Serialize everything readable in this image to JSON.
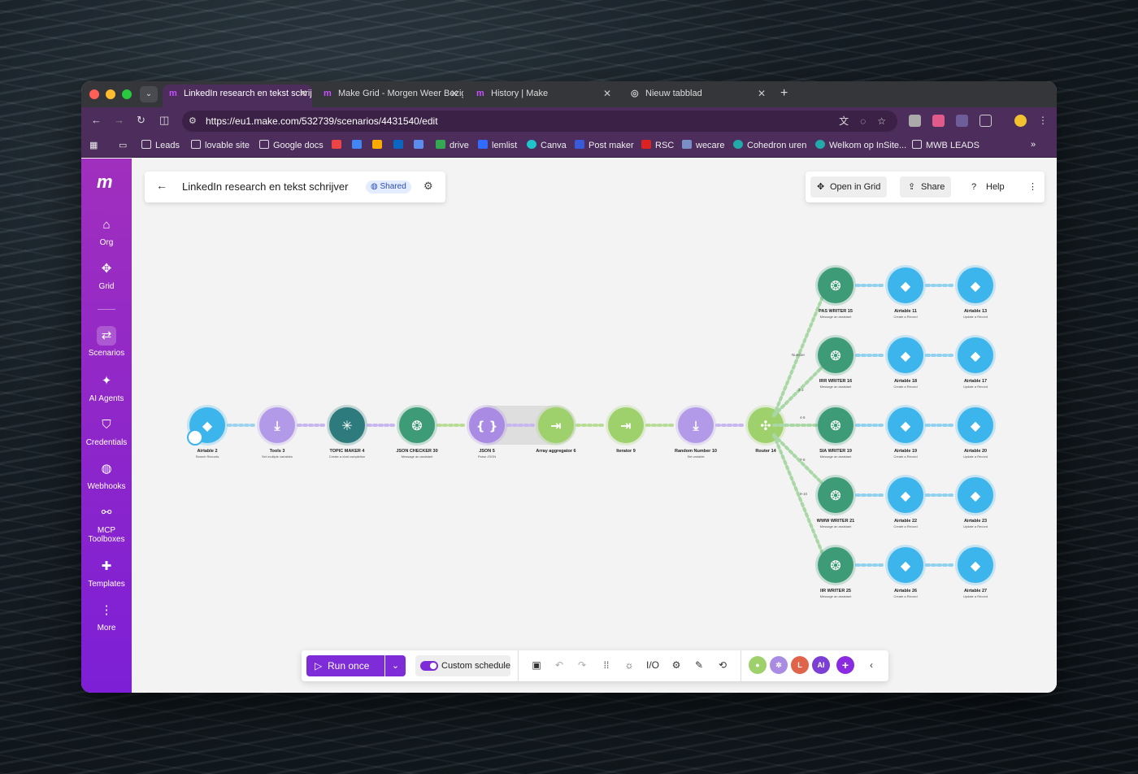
{
  "tabs": [
    {
      "label": "LinkedIn research en tekst schrijver",
      "active": true
    },
    {
      "label": "Make Grid - Morgen Weer Bezig",
      "active": false
    },
    {
      "label": "History | Make",
      "active": false
    },
    {
      "label": "Nieuw tabblad",
      "active": false
    }
  ],
  "url": "https://eu1.make.com/532739/scenarios/4431540/edit",
  "bookmarks": [
    "Leads",
    "lovable site",
    "Google docs",
    "drive",
    "lemlist",
    "Canva",
    "Post maker",
    "RSC",
    "wecare",
    "Cohedron uren",
    "Welkom op InSite...",
    "MWB LEADS"
  ],
  "sidebar": {
    "items": [
      {
        "label": "Org",
        "icon": "home-icon"
      },
      {
        "label": "Grid",
        "icon": "grid-icon"
      },
      {
        "label": "Scenarios",
        "icon": "share-icon",
        "selected": true
      },
      {
        "label": "AI Agents",
        "icon": "ai-agent-icon"
      },
      {
        "label": "Credentials",
        "icon": "shield-icon"
      },
      {
        "label": "Webhooks",
        "icon": "globe-icon"
      },
      {
        "label": "MCP Toolboxes",
        "icon": "mcp-icon"
      },
      {
        "label": "Templates",
        "icon": "puzzle-icon"
      },
      {
        "label": "More",
        "icon": "more-vertical-icon"
      }
    ]
  },
  "header": {
    "title": "LinkedIn research en tekst schrijver",
    "shared": "Shared"
  },
  "actions": {
    "open_grid": "Open in Grid",
    "share": "Share",
    "help": "Help"
  },
  "toolbar": {
    "run": "Run once",
    "schedule": "Custom schedule"
  },
  "colors": {
    "airtable": "#3cb4ec",
    "tools": "#b39ae8",
    "topic": "#2e7b7d",
    "openai": "#3e9b78",
    "json": "#a98be3",
    "flow": "#9ed06b",
    "router": "#9ed06b",
    "brand": "#7d2cd8"
  },
  "nodes": [
    {
      "id": "n1",
      "type": "airtable",
      "title": "Airtable",
      "num": "2",
      "sub": "Search Records"
    },
    {
      "id": "n2",
      "type": "tools",
      "title": "Tools",
      "num": "3",
      "sub": "Set multiple variables"
    },
    {
      "id": "n3",
      "type": "topic",
      "title": "TOPIC MAKER",
      "num": "4",
      "sub": "Create a chat completion"
    },
    {
      "id": "n4",
      "type": "openai",
      "title": "JSON CHECKER",
      "num": "30",
      "sub": "Message an assistant"
    },
    {
      "id": "n5",
      "type": "json",
      "title": "JSON",
      "num": "5",
      "sub": "Parse JSON"
    },
    {
      "id": "n6",
      "type": "flow",
      "title": "Array aggregator",
      "num": "6",
      "sub": ""
    },
    {
      "id": "n7",
      "type": "flow",
      "title": "Iterator",
      "num": "9",
      "sub": ""
    },
    {
      "id": "n8",
      "type": "tools",
      "title": "Random Number",
      "num": "10",
      "sub": "Set variable"
    },
    {
      "id": "n9",
      "type": "router",
      "title": "Router",
      "num": "14",
      "sub": ""
    }
  ],
  "branches": [
    {
      "writer": "PAS WRITER",
      "wnum": "15",
      "a1": "Airtable",
      "a1num": "11",
      "a2": "Airtable",
      "a2num": "13"
    },
    {
      "writer": "IRR WRITER",
      "wnum": "16",
      "a1": "Airtable",
      "a1num": "18",
      "a2": "Airtable",
      "a2num": "17"
    },
    {
      "writer": "SIA WRITER",
      "wnum": "19",
      "a1": "Airtable",
      "a1num": "19",
      "a2": "Airtable",
      "a2num": "20"
    },
    {
      "writer": "WWW WRITER",
      "wnum": "21",
      "a1": "Airtable",
      "a1num": "22",
      "a2": "Airtable",
      "a2num": "23"
    },
    {
      "writer": "IIR WRITER",
      "wnum": "25",
      "a1": "Airtable",
      "a1num": "26",
      "a2": "Airtable",
      "a2num": "27"
    }
  ],
  "branch_subs": {
    "writer": "Message an assistant",
    "a1": "Create a Record",
    "a2": "Update a Record"
  },
  "route_labels": [
    "Number",
    "2-3",
    "4-6",
    "7-8",
    "9-10"
  ],
  "avatars": [
    "AI"
  ]
}
